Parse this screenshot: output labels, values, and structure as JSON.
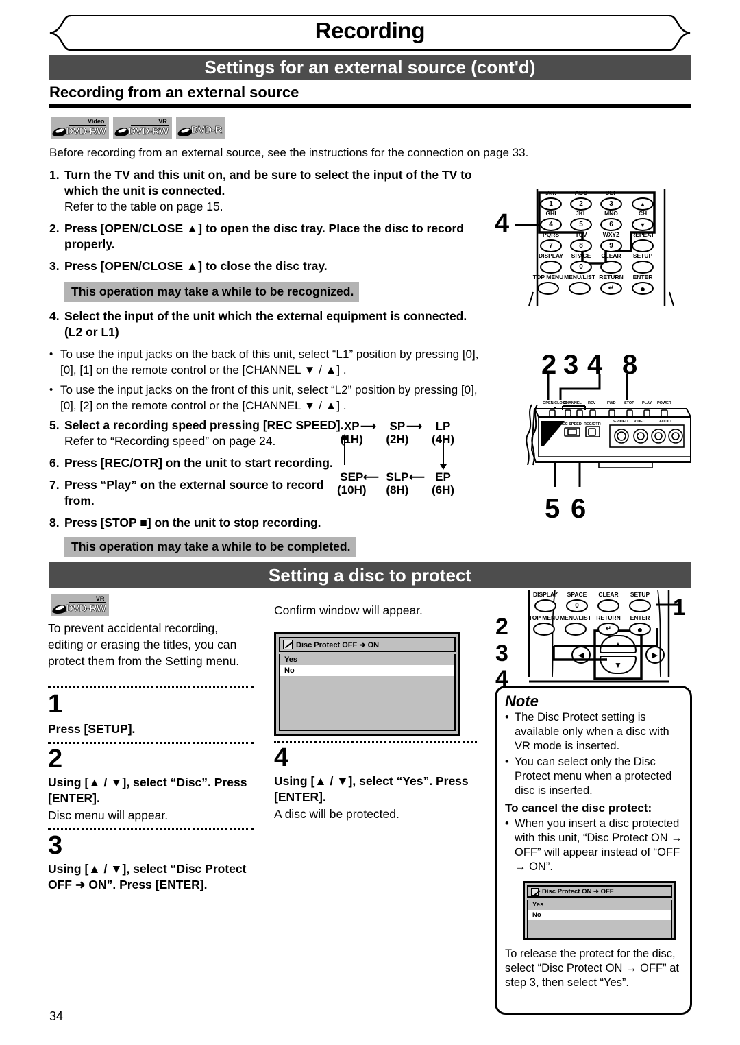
{
  "page": {
    "chapter_title": "Recording",
    "page_number": "34"
  },
  "section_external": {
    "bar_title": "Settings for an external source (cont'd)",
    "subhead": "Recording from an external source",
    "media_logos": [
      {
        "mode": "Video",
        "name": "DVD-RW"
      },
      {
        "mode": "VR",
        "name": "DVD-RW"
      },
      {
        "mode": "",
        "name": "DVD-R"
      }
    ],
    "intro": "Before recording from an external source, see the instructions for the connection on page 33.",
    "steps": [
      {
        "num": "1.",
        "bold": "Turn the TV and this unit on, and be sure to select the input of the TV to which the unit is connected.",
        "plain": "Refer to the table on page 15."
      },
      {
        "num": "2.",
        "bold": "Press [OPEN/CLOSE ▲] to open the disc tray. Place the disc to record properly.",
        "plain": ""
      },
      {
        "num": "3.",
        "bold": "Press [OPEN/CLOSE ▲] to close the disc tray.",
        "plain": ""
      }
    ],
    "highlight_1": "This operation may take a while to be recognized.",
    "step4": {
      "num": "4.",
      "bold": "Select the input of the unit which the external equipment is connected. (L2 or L1)"
    },
    "bullets": [
      "To use the input jacks on the back of this unit, select “L1” position by pressing [0], [0], [1] on the remote control or the [CHANNEL ▼ / ▲] .",
      "To use the input jacks on the front of this unit, select “L2” position by pressing [0], [0], [2] on the remote control or the [CHANNEL ▼ / ▲] ."
    ],
    "steps_late": [
      {
        "num": "5.",
        "bold": "Select a recording speed pressing [REC SPEED].",
        "plain": "Refer to “Recording speed” on page 24."
      },
      {
        "num": "6.",
        "bold": "Press [REC/OTR] on the unit to start recording.",
        "plain": ""
      },
      {
        "num": "7.",
        "bold": "Press “Play” on the external source to record from.",
        "plain": ""
      },
      {
        "num": "8.",
        "bold": "Press [STOP ■] on the unit to stop recording.",
        "plain": ""
      }
    ],
    "highlight_2": "This operation may take a while to be completed.",
    "speed_cycle": {
      "top_row": [
        {
          "mode": "XP",
          "hours": "(1H)"
        },
        {
          "mode": "SP",
          "hours": "(2H)"
        },
        {
          "mode": "LP",
          "hours": "(4H)"
        }
      ],
      "bottom_row": [
        {
          "mode": "SEP",
          "hours": "(10H)"
        },
        {
          "mode": "SLP",
          "hours": "(8H)"
        },
        {
          "mode": "EP",
          "hours": "(6H)"
        }
      ]
    },
    "remote_top": {
      "callout": "4",
      "keys": [
        {
          "label": ".@/:",
          "glyph": "1"
        },
        {
          "label": "ABC",
          "glyph": "2"
        },
        {
          "label": "DEF",
          "glyph": "3"
        },
        {
          "label": "",
          "glyph": "▲"
        },
        {
          "label": "GHI",
          "glyph": "4"
        },
        {
          "label": "JKL",
          "glyph": "5"
        },
        {
          "label": "MNO",
          "glyph": "6"
        },
        {
          "label": "CH",
          "glyph": "▼"
        },
        {
          "label": "PQRS",
          "glyph": "7"
        },
        {
          "label": "TUV",
          "glyph": "8"
        },
        {
          "label": "WXYZ",
          "glyph": "9"
        },
        {
          "label": "REPEAT",
          "glyph": ""
        },
        {
          "label": "DISPLAY",
          "glyph": ""
        },
        {
          "label": "SPACE",
          "glyph": "0"
        },
        {
          "label": "CLEAR",
          "glyph": ""
        },
        {
          "label": "SETUP",
          "glyph": ""
        },
        {
          "label": "TOP MENU",
          "glyph": ""
        },
        {
          "label": "MENU/LIST",
          "glyph": ""
        },
        {
          "label": "RETURN",
          "glyph": "↵"
        },
        {
          "label": "ENTER",
          "glyph": "●"
        }
      ]
    },
    "front_panel": {
      "callouts_top": [
        "2",
        "3",
        "4",
        "8"
      ],
      "callouts_bottom": [
        "5",
        "6"
      ],
      "top_buttons": [
        "OPEN/CLOSE",
        "CHANNEL",
        "REV",
        "FWD",
        "STOP",
        "PLAY",
        "POWER"
      ],
      "front_buttons": [
        "REC SPEED",
        "REC/OTR"
      ],
      "jacks": [
        "S-VIDEO",
        "VIDEO",
        "AUDIO"
      ]
    }
  },
  "section_protect": {
    "bar_title": "Setting a disc to protect",
    "media_logo": {
      "mode": "VR",
      "name": "DVD-RW"
    },
    "lead": "To prevent accidental recording, editing or erasing the titles, you can protect them from the Setting menu.",
    "steps": [
      {
        "num": "1",
        "bold": "Press [SETUP].",
        "plain": ""
      },
      {
        "num": "2",
        "bold": "Using [▲ / ▼], select “Disc”. Press [ENTER].",
        "plain": "Disc menu will appear."
      },
      {
        "num": "3",
        "bold": "Using [▲ / ▼], select “Disc Protect OFF ➜ ON”. Press [ENTER].",
        "plain": ""
      },
      {
        "num": "4",
        "bold": "Using [▲ / ▼], select “Yes”. Press [ENTER].",
        "plain": "A disc will be protected."
      }
    ],
    "confirm_caption": "Confirm window will appear.",
    "osd_main": {
      "title": "Disc Protect OFF ➜ ON",
      "items": [
        "Yes",
        "No"
      ],
      "selected": "No"
    },
    "remote_keys": {
      "callouts": [
        "1",
        "2",
        "3",
        "4"
      ],
      "keys": [
        {
          "label": "DISPLAY",
          "glyph": ""
        },
        {
          "label": "SPACE",
          "glyph": "0"
        },
        {
          "label": "CLEAR",
          "glyph": ""
        },
        {
          "label": "SETUP",
          "glyph": ""
        },
        {
          "label": "TOP MENU",
          "glyph": ""
        },
        {
          "label": "MENU/LIST",
          "glyph": ""
        },
        {
          "label": "RETURN",
          "glyph": "↵"
        },
        {
          "label": "ENTER",
          "glyph": "●"
        }
      ],
      "dpad": [
        "▲",
        "▼",
        "◀",
        "▶"
      ]
    },
    "note": {
      "title": "Note",
      "bullets": [
        "The Disc Protect setting is available only when a disc with VR mode is inserted.",
        "You can select only the Disc Protect menu when a protected disc is inserted."
      ],
      "cancel_head": "To cancel the disc protect:",
      "cancel_bullet": "When you insert a disc protected with this unit, “Disc Protect ON → OFF” will appear instead of “OFF → ON”.",
      "osd": {
        "title": "Disc Protect ON ➜ OFF",
        "items": [
          "Yes",
          "No"
        ],
        "selected": "No"
      },
      "tail": "To release the protect for the disc, select “Disc Protect ON → OFF” at step 3, then select “Yes”."
    }
  },
  "colors": {
    "section_bar": "#4d4d4d",
    "highlight": "#b3b3b3",
    "osd_bg": "#c0c0c0"
  }
}
